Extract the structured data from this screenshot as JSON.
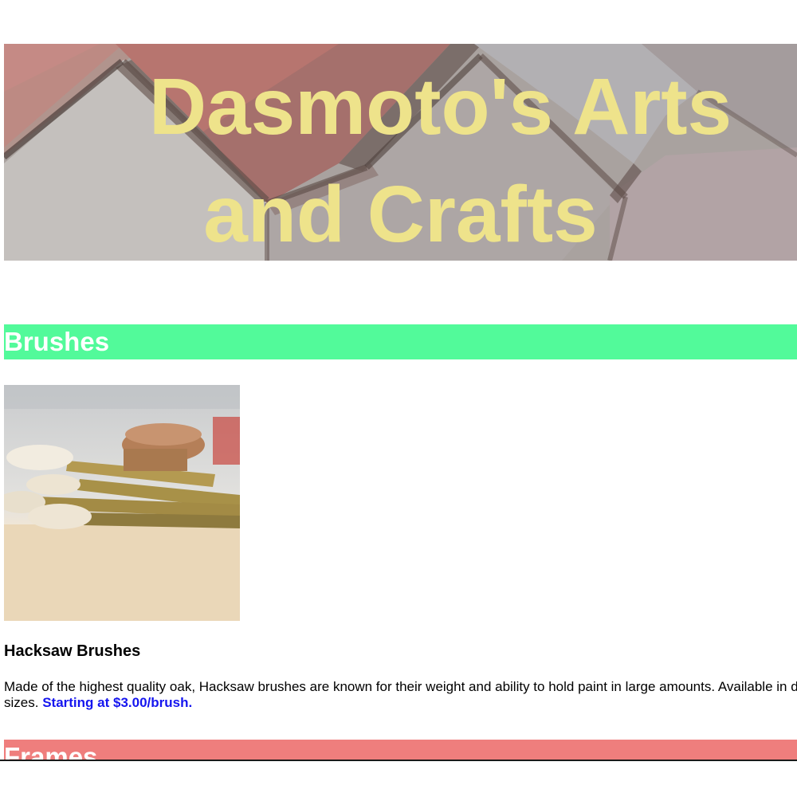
{
  "banner": {
    "title_line1": "Dasmoto's Arts",
    "title_line2": "and Crafts",
    "title_color": "#eee38b"
  },
  "sections": {
    "brushes": {
      "heading": "Brushes",
      "color": "#52fa9a"
    },
    "frames": {
      "heading": "Frames",
      "color": "#ef7e7d"
    }
  },
  "product": {
    "name": "Hacksaw Brushes",
    "description": "Made of the highest quality oak, Hacksaw brushes are known for their weight and ability to hold paint in large amounts. Available in different sizes.",
    "price": "Starting at $3.00/brush.",
    "price_color": "#1515ef"
  }
}
